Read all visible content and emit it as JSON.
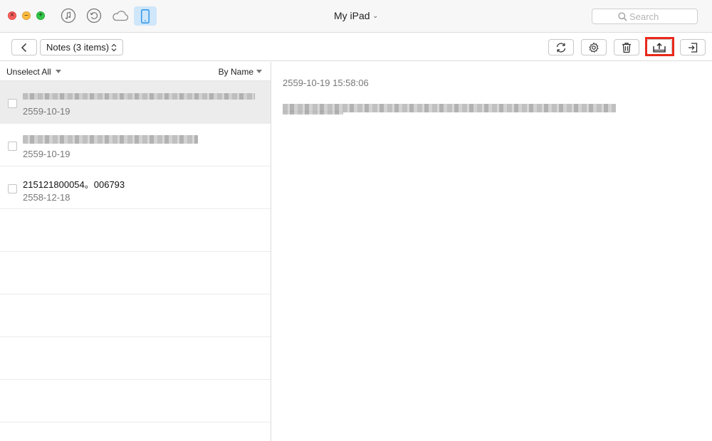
{
  "window": {
    "title": "My iPad"
  },
  "topbar": {
    "icons": [
      "music-note-icon",
      "history-icon",
      "cloud-icon",
      "ipad-device-icon"
    ],
    "active_icon": "ipad-device-icon",
    "search_placeholder": "Search"
  },
  "toolbar": {
    "category_select": "Notes (3 items)",
    "actions": [
      "refresh-icon",
      "settings-icon",
      "delete-icon",
      "export-to-computer-icon",
      "import-icon"
    ],
    "highlighted_action": "export-to-computer-icon",
    "highlight_color": "#e8291c"
  },
  "list": {
    "select_toggle": "Unselect All",
    "sort_label": "By Name",
    "items": [
      {
        "title": "",
        "title_redacted": true,
        "date": "2559-10-19",
        "selected": true
      },
      {
        "title": "",
        "title_redacted": true,
        "date": "2559-10-19",
        "selected": false
      },
      {
        "title": "215121800054。006793",
        "title_redacted": false,
        "date": "2558-12-18",
        "selected": false
      }
    ]
  },
  "detail": {
    "date": "2559-10-19 15:58:06",
    "body_redacted": true
  },
  "colors": {
    "active_device_bg": "#cfe6fb",
    "selected_row_bg": "#ececec",
    "close": "#fc605c",
    "minimize": "#fdbc40",
    "maximize": "#34c84a"
  }
}
